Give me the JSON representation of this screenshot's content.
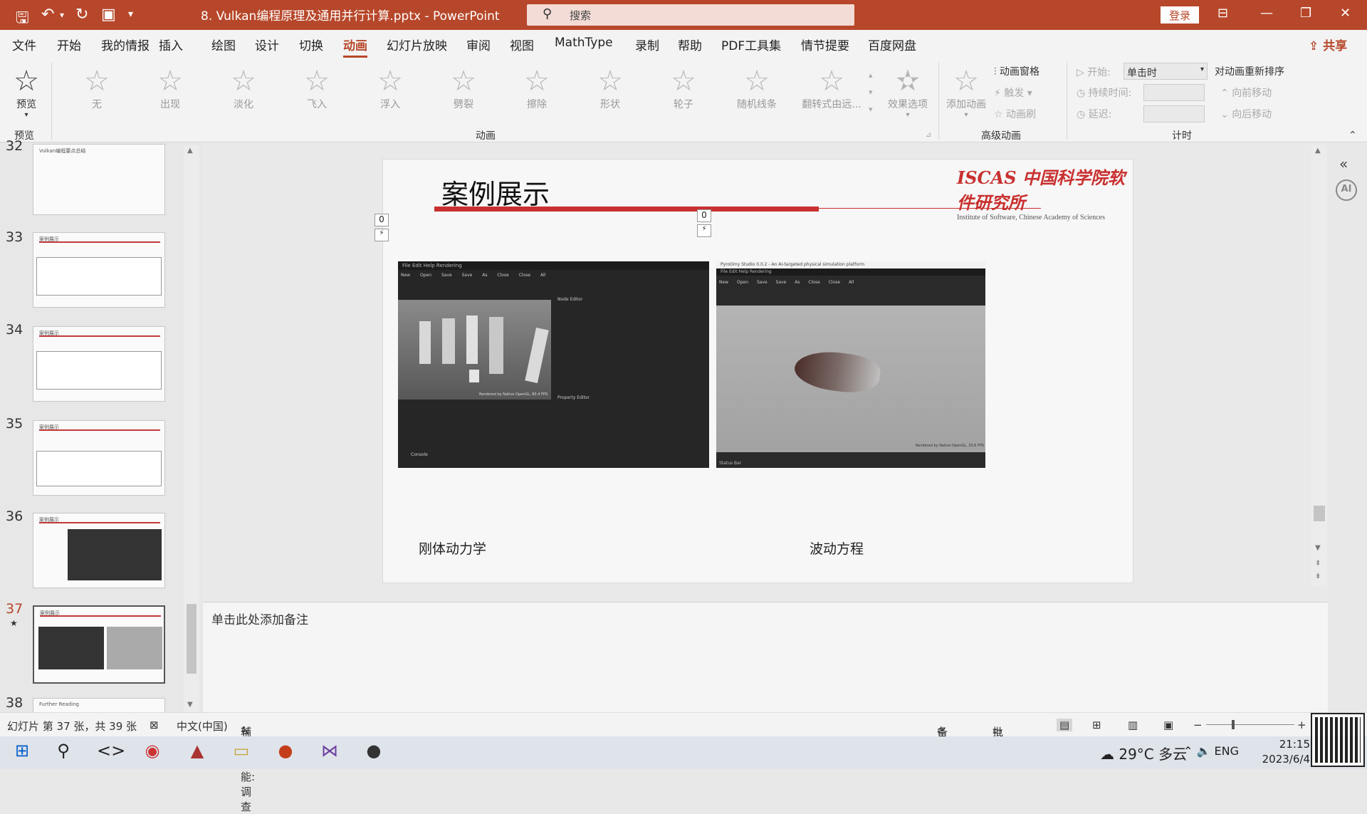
{
  "titlebar": {
    "doc_title": "8. Vulkan编程原理及通用并行计算.pptx  -  PowerPoint",
    "search_placeholder": "搜索",
    "login": "登录"
  },
  "menu": {
    "items": [
      "文件",
      "开始",
      "我的情报",
      "插入",
      "绘图",
      "设计",
      "切换",
      "动画",
      "幻灯片放映",
      "审阅",
      "视图",
      "MathType",
      "录制",
      "帮助",
      "PDF工具集",
      "情节提要",
      "百度网盘"
    ],
    "share": "共享"
  },
  "ribbon": {
    "preview": {
      "label": "预览",
      "group": "预览"
    },
    "effects": [
      "无",
      "出现",
      "淡化",
      "飞入",
      "浮入",
      "劈裂",
      "擦除",
      "形状",
      "轮子",
      "随机线条",
      "翻转式由远...",
      "效果选项"
    ],
    "group_animation": "动画",
    "advanced": {
      "add_animation": "添加动画",
      "pane": "动画窗格",
      "trigger": "触发",
      "painter": "动画刷",
      "group": "高级动画"
    },
    "timing": {
      "start_label": "开始:",
      "start_value": "单击时",
      "duration_label": "持续时间:",
      "delay_label": "延迟:",
      "reorder": "对动画重新排序",
      "move_earlier": "向前移动",
      "move_later": "向后移动",
      "group": "计时"
    }
  },
  "thumbnails": [
    {
      "num": "32",
      "title": "Vulkan编程要点总结"
    },
    {
      "num": "33",
      "title": "案例展示"
    },
    {
      "num": "34",
      "title": "案例展示"
    },
    {
      "num": "35",
      "title": "案例展示"
    },
    {
      "num": "36",
      "title": "案例展示"
    },
    {
      "num": "37",
      "title": "案例展示",
      "star": "★"
    },
    {
      "num": "38",
      "title": "Further Reading"
    }
  ],
  "slide": {
    "title": "案例展示",
    "logo_main": "ISCAS 中国科学院软件研究所",
    "logo_sub": "Institute of Software, Chinese Academy of Sciences",
    "anim_badge_left": "0",
    "anim_badge_right": "0",
    "left_caption": "刚体动力学",
    "right_caption": "波动方程",
    "left_shot": {
      "menu": "File  Edit  Help  Rendering",
      "toolbar": [
        "New",
        "Open",
        "Save",
        "Save As",
        "Close",
        "Close All"
      ],
      "node_editor": "Node Editor",
      "property_editor": "Property Editor",
      "console": "Console",
      "render_info": "Rendered by Native OpenGL, 60.4 FPS"
    },
    "right_shot": {
      "window_title": "PyroOmy Studio 0.0.2 - An AI-targeted physical simulation platform",
      "menu": "File  Edit  Help  Rendering",
      "toolbar": [
        "New",
        "Open",
        "Save",
        "Save As",
        "Close",
        "Close All"
      ],
      "render_info": "Rendered by Native OpenGL, 33.6 FPS",
      "status": "Status Bar"
    }
  },
  "notes": {
    "placeholder": "单击此处添加备注"
  },
  "status": {
    "slide_info": "幻灯片 第 37 张，共 39 张",
    "language": "中文(中国)",
    "accessibility": "辅助功能: 调查",
    "notes_btn": "备注",
    "comments_btn": "批注"
  },
  "taskbar": {
    "weather": "29°C 多云",
    "lang": "ENG",
    "time": "21:15",
    "date": "2023/6/4"
  }
}
